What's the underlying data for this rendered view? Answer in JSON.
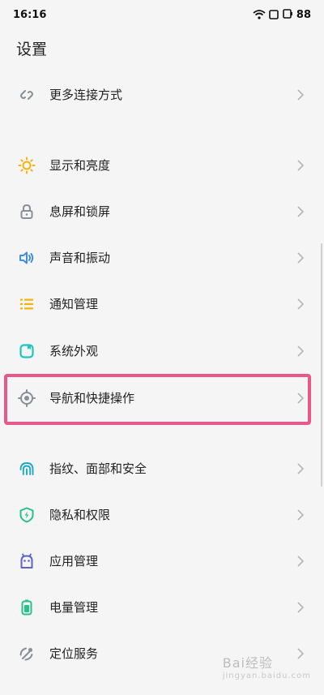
{
  "status_bar": {
    "time": "16:16",
    "battery": "88",
    "icons": [
      "wifi-icon",
      "rectangle-icon",
      "battery-icon"
    ]
  },
  "page": {
    "title": "设置"
  },
  "items": [
    {
      "label": "更多连接方式",
      "icon": "link-icon",
      "color": "#8a8f96"
    },
    {
      "label": "显示和亮度",
      "icon": "sun-icon",
      "color": "#f5b20b"
    },
    {
      "label": "息屏和锁屏",
      "icon": "lock-icon",
      "color": "#8a8f96"
    },
    {
      "label": "声音和振动",
      "icon": "speaker-icon",
      "color": "#3f8ee0"
    },
    {
      "label": "通知管理",
      "icon": "list-icon",
      "color": "#f5b20b"
    },
    {
      "label": "系统外观",
      "icon": "appearance-icon",
      "color": "#1fc6c0"
    },
    {
      "label": "导航和快捷操作",
      "icon": "target-icon",
      "color": "#8a8f96"
    },
    {
      "label": "指纹、面部和安全",
      "icon": "fingerprint-icon",
      "color": "#1fa8c6"
    },
    {
      "label": "隐私和权限",
      "icon": "shield-icon",
      "color": "#27c28a"
    },
    {
      "label": "应用管理",
      "icon": "android-icon",
      "color": "#5a63c9"
    },
    {
      "label": "电量管理",
      "icon": "battery-icon",
      "color": "#27c28a"
    },
    {
      "label": "定位服务",
      "icon": "location-icon",
      "color": "#8a8f96"
    }
  ],
  "watermark": {
    "text": "Bai经验",
    "sub": "jingyan.baidu.com"
  }
}
